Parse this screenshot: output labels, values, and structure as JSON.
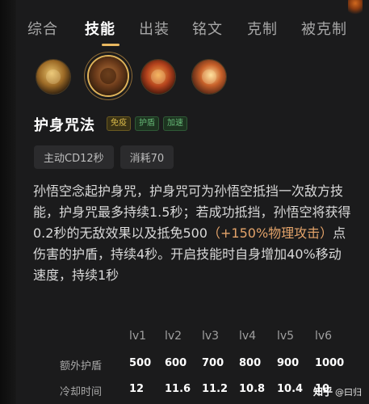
{
  "tabs": [
    "综合",
    "技能",
    "出装",
    "铭文",
    "克制",
    "被克制"
  ],
  "skill_icons": [
    "skill-1",
    "skill-2-selected",
    "skill-3",
    "skill-4"
  ],
  "skill": {
    "name": "护身咒法",
    "tags": [
      "免疫",
      "护盾",
      "加速"
    ],
    "stats": [
      "主动CD12秒",
      "消耗70"
    ],
    "description": {
      "part1": "孙悟空念起护身咒，护身咒可为孙悟空抵挡一次敌方技能，护身咒最多持续1.5秒；若成功抵挡，孙悟空将获得0.2秒的无敌效果以及抵免500",
      "highlight": "（+150%物理攻击）",
      "part2": "点伤害的护盾，持续4秒。开启技能时自身增加40%移动速度，持续1秒"
    }
  },
  "table": {
    "levels": [
      "lv1",
      "lv2",
      "lv3",
      "lv4",
      "lv5",
      "lv6"
    ],
    "rows": [
      {
        "label": "额外护盾",
        "values": [
          "500",
          "600",
          "700",
          "800",
          "900",
          "1000"
        ]
      },
      {
        "label": "冷却时间",
        "values": [
          "12",
          "11.6",
          "11.2",
          "10.8",
          "10.4",
          "10"
        ]
      }
    ]
  },
  "watermark": {
    "site": "知乎",
    "user": "@曰归"
  }
}
